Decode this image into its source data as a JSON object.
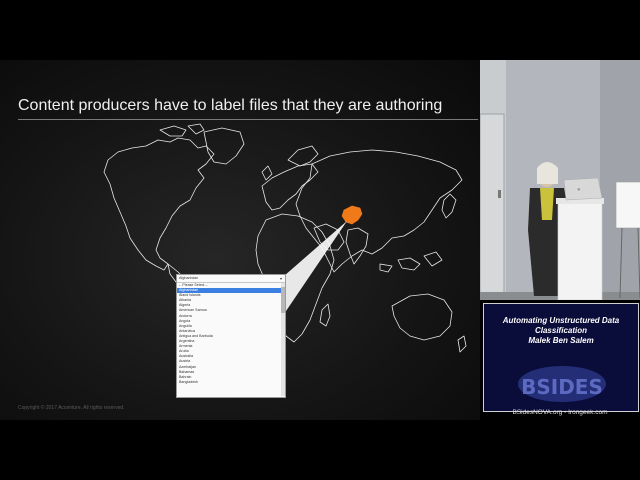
{
  "slide": {
    "title": "Content producers have to label files that they are authoring",
    "copyright": "Copyright © 2017 Accenture. All rights reserved.",
    "map_highlight_color": "#f07a1a"
  },
  "dropdown": {
    "selected": "Afghanistan",
    "options": [
      "-- Please Select --",
      "Afghanistan",
      "Åland Islands",
      "Albania",
      "Algeria",
      "American Samoa",
      "Andorra",
      "Angola",
      "Anguilla",
      "Antarctica",
      "Antigua and Barbuda",
      "Argentina",
      "Armenia",
      "Aruba",
      "Australia",
      "Austria",
      "Azerbaijan",
      "Bahamas",
      "Bahrain",
      "Bangladesh"
    ],
    "highlighted_index": 1
  },
  "overlay": {
    "title_line1": "Automating Unstructured Data",
    "title_line2": "Classification",
    "speaker": "Malek Ben Salem",
    "logo_text": "BSIDES",
    "footer": "BSidesNOVA.org • Irongeek.com"
  },
  "video": {
    "laptop_logo": "apple-icon"
  }
}
